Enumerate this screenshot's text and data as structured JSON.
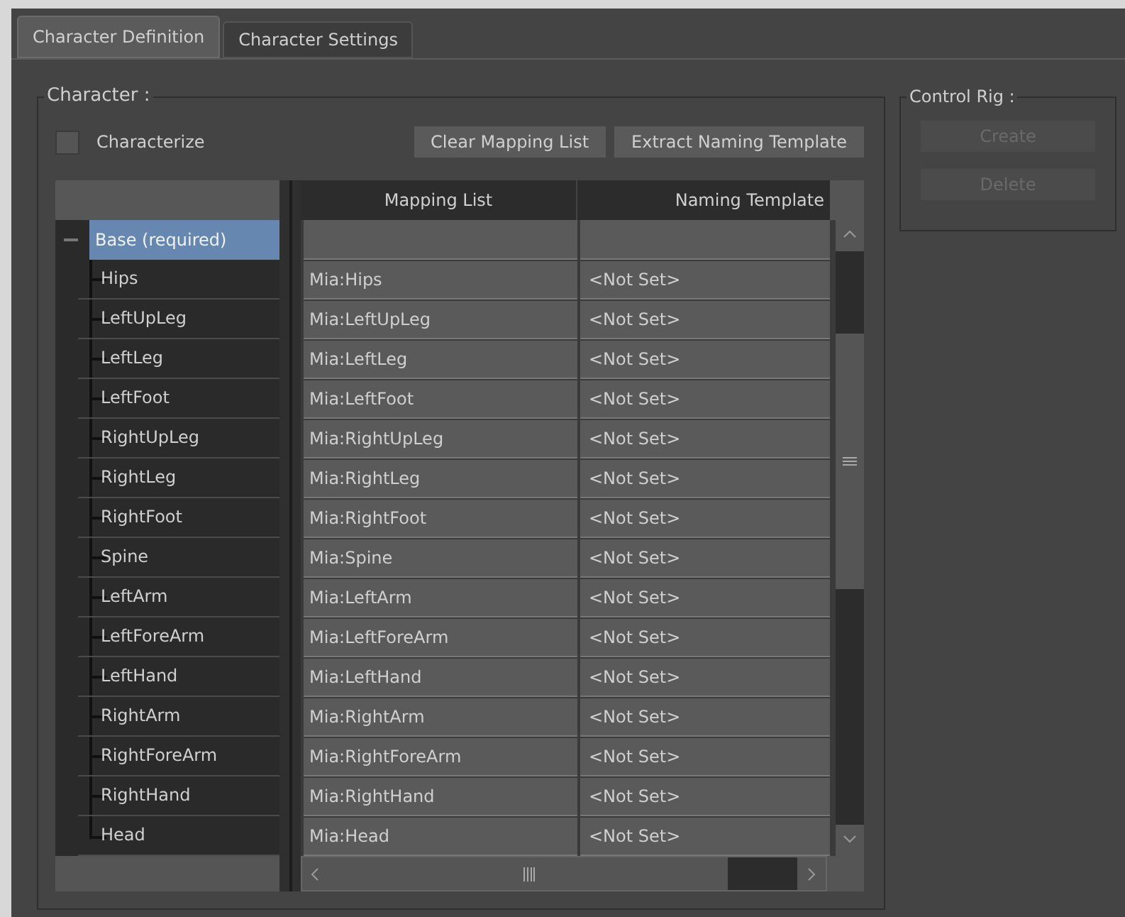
{
  "tabs": [
    {
      "label": "Character Definition",
      "selected": true
    },
    {
      "label": "Character Settings",
      "selected": false
    }
  ],
  "character": {
    "title": "Character :",
    "characterize": {
      "label": "Characterize",
      "checked": false
    },
    "buttons": [
      {
        "label": "Clear Mapping List"
      },
      {
        "label": "Extract Naming Template"
      }
    ],
    "tree": {
      "label": "Base (required)",
      "selected": true,
      "expanded": true,
      "children": [
        {
          "label": "Hips"
        },
        {
          "label": "LeftUpLeg"
        },
        {
          "label": "LeftLeg"
        },
        {
          "label": "LeftFoot"
        },
        {
          "label": "RightUpLeg"
        },
        {
          "label": "RightLeg"
        },
        {
          "label": "RightFoot"
        },
        {
          "label": "Spine"
        },
        {
          "label": "LeftArm"
        },
        {
          "label": "LeftForeArm"
        },
        {
          "label": "LeftHand"
        },
        {
          "label": "RightArm"
        },
        {
          "label": "RightForeArm"
        },
        {
          "label": "RightHand"
        },
        {
          "label": "Head"
        }
      ]
    },
    "table": {
      "columns": [
        "Mapping List",
        "Naming Template"
      ],
      "rows": [
        {
          "mapping": "Mia:Hips",
          "template": "<Not Set>"
        },
        {
          "mapping": "Mia:LeftUpLeg",
          "template": "<Not Set>"
        },
        {
          "mapping": "Mia:LeftLeg",
          "template": "<Not Set>"
        },
        {
          "mapping": "Mia:LeftFoot",
          "template": "<Not Set>"
        },
        {
          "mapping": "Mia:RightUpLeg",
          "template": "<Not Set>"
        },
        {
          "mapping": "Mia:RightLeg",
          "template": "<Not Set>"
        },
        {
          "mapping": "Mia:RightFoot",
          "template": "<Not Set>"
        },
        {
          "mapping": "Mia:Spine",
          "template": "<Not Set>"
        },
        {
          "mapping": "Mia:LeftArm",
          "template": "<Not Set>"
        },
        {
          "mapping": "Mia:LeftForeArm",
          "template": "<Not Set>"
        },
        {
          "mapping": "Mia:LeftHand",
          "template": "<Not Set>"
        },
        {
          "mapping": "Mia:RightArm",
          "template": "<Not Set>"
        },
        {
          "mapping": "Mia:RightForeArm",
          "template": "<Not Set>"
        },
        {
          "mapping": "Mia:RightHand",
          "template": "<Not Set>"
        },
        {
          "mapping": "Mia:Head",
          "template": "<Not Set>"
        }
      ]
    }
  },
  "control_rig": {
    "title": "Control Rig :",
    "buttons": [
      {
        "label": "Create",
        "disabled": true
      },
      {
        "label": "Delete",
        "disabled": true
      }
    ]
  }
}
